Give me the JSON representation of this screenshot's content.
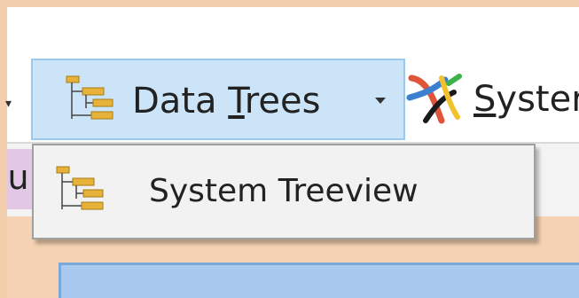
{
  "left_tab": {
    "partial_text": "lu"
  },
  "toolbar": {
    "data_trees": {
      "label_prefix": "Data ",
      "label_accel": "T",
      "label_suffix": "rees",
      "icon": "tree-hierarchy-icon",
      "has_dropdown": true
    },
    "systems": {
      "label_accel": "S",
      "label_rest": "yster",
      "icon": "systems-icon"
    }
  },
  "dropdown_menu": {
    "items": [
      {
        "label": "System Treeview",
        "icon": "tree-hierarchy-icon"
      }
    ]
  },
  "colors": {
    "frame": "#f3cfae",
    "toolbar_bg": "#ffffff",
    "hover_bg": "#cce4f7",
    "hover_border": "#99c9ef",
    "menu_bg": "#f2f2f2",
    "menu_border": "#a0a0a0",
    "tree_icon_fill": "#e6b23a",
    "panel_blue": "#a9c9ee"
  }
}
